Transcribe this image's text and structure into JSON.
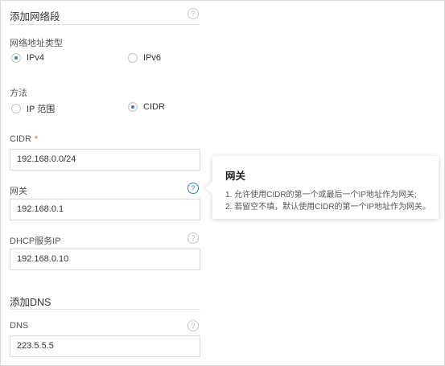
{
  "add_segment": {
    "title": "添加网络段"
  },
  "address_type": {
    "label": "网络地址类型",
    "options": [
      {
        "label": "IPv4",
        "checked": true
      },
      {
        "label": "IPv6",
        "checked": false
      }
    ]
  },
  "method": {
    "label": "方法",
    "options": [
      {
        "label": "IP 范围",
        "checked": false
      },
      {
        "label": "CIDR",
        "checked": true
      }
    ]
  },
  "cidr": {
    "label": "CIDR",
    "required_mark": "*",
    "value": "192.168.0.0/24"
  },
  "gateway": {
    "label": "网关",
    "value": "192.168.0.1"
  },
  "dhcp": {
    "label": "DHCP服务IP",
    "value": "192.168.0.10"
  },
  "add_dns": {
    "title": "添加DNS"
  },
  "dns": {
    "label": "DNS",
    "value": "223.5.5.5"
  },
  "tooltip": {
    "title": "网关",
    "lines": [
      "1. 允许使用CIDR的第一个或最后一个IP地址作为网关;",
      "2. 若留空不填，默认使用CIDR的第一个IP地址作为网关。"
    ]
  },
  "help_icon_glyph": "?",
  "colors": {
    "accent": "#2b7fd4",
    "required": "#e05a5a",
    "border": "#d9d9d9"
  }
}
